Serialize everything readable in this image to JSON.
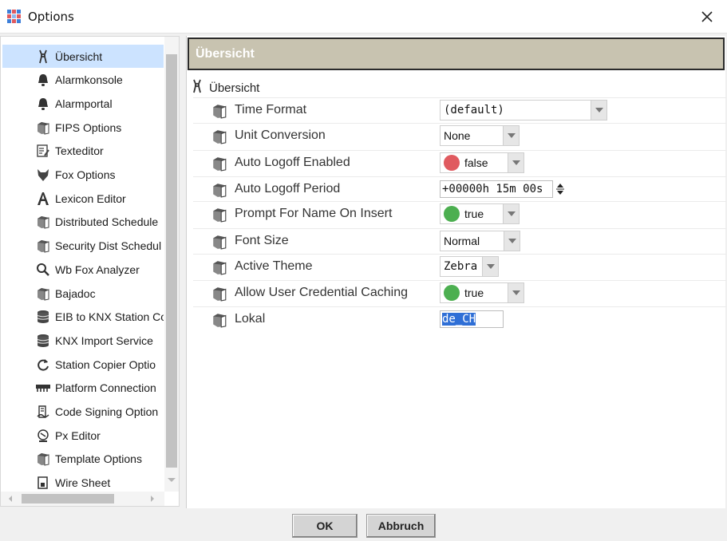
{
  "window": {
    "title": "Options"
  },
  "sidebar": {
    "items": [
      {
        "label": "Übersicht",
        "icon": "wrench-icon",
        "selected": true
      },
      {
        "label": "Alarmkonsole",
        "icon": "bell-icon"
      },
      {
        "label": "Alarmportal",
        "icon": "bell-icon"
      },
      {
        "label": "FIPS Options",
        "icon": "options-cube-icon"
      },
      {
        "label": "Texteditor",
        "icon": "text-editor-icon"
      },
      {
        "label": "Fox Options",
        "icon": "fox-icon"
      },
      {
        "label": "Lexicon Editor",
        "icon": "letter-a-icon"
      },
      {
        "label": "Distributed Schedule",
        "icon": "options-cube-icon"
      },
      {
        "label": "Security Dist Schedul",
        "icon": "options-cube-icon"
      },
      {
        "label": "Wb Fox Analyzer",
        "icon": "magnifier-icon"
      },
      {
        "label": "Bajadoc",
        "icon": "options-cube-icon"
      },
      {
        "label": "EIB to KNX Station Co",
        "icon": "database-icon"
      },
      {
        "label": "KNX Import Service",
        "icon": "database-icon"
      },
      {
        "label": "Station Copier Optio",
        "icon": "refresh-icon"
      },
      {
        "label": "Platform Connection",
        "icon": "connector-icon"
      },
      {
        "label": "Code Signing Option",
        "icon": "signing-icon"
      },
      {
        "label": "Px Editor",
        "icon": "px-editor-icon"
      },
      {
        "label": "Template Options",
        "icon": "options-cube-icon"
      },
      {
        "label": "Wire Sheet",
        "icon": "wire-sheet-icon"
      }
    ]
  },
  "main": {
    "header_title": "Übersicht",
    "tree_root_label": "Übersicht",
    "properties": [
      {
        "name": "Time Format",
        "control": "combo",
        "value": "(default)",
        "mono": true
      },
      {
        "name": "Unit Conversion",
        "control": "combo",
        "value": "None"
      },
      {
        "name": "Auto Logoff Enabled",
        "control": "boolcombo",
        "value": "false",
        "dot_color": "#e05a5f"
      },
      {
        "name": "Auto Logoff Period",
        "control": "reltime",
        "value": "+00000h 15m 00s"
      },
      {
        "name": "Prompt For Name On Insert",
        "control": "boolcombo",
        "value": "true",
        "dot_color": "#4caf50"
      },
      {
        "name": "Font Size",
        "control": "combo",
        "value": "Normal"
      },
      {
        "name": "Active Theme",
        "control": "combo",
        "value": "Zebra",
        "mono": true
      },
      {
        "name": "Allow User Credential Caching",
        "control": "boolcombo",
        "value": "true",
        "dot_color": "#4caf50"
      },
      {
        "name": "Lokal",
        "control": "text",
        "value": "de_CH"
      }
    ]
  },
  "footer": {
    "ok_label": "OK",
    "cancel_label": "Abbruch"
  },
  "colors": {
    "header_bg": "#c8c3b0",
    "selection": "#cce3ff",
    "text_selection": "#2f6fd6"
  }
}
